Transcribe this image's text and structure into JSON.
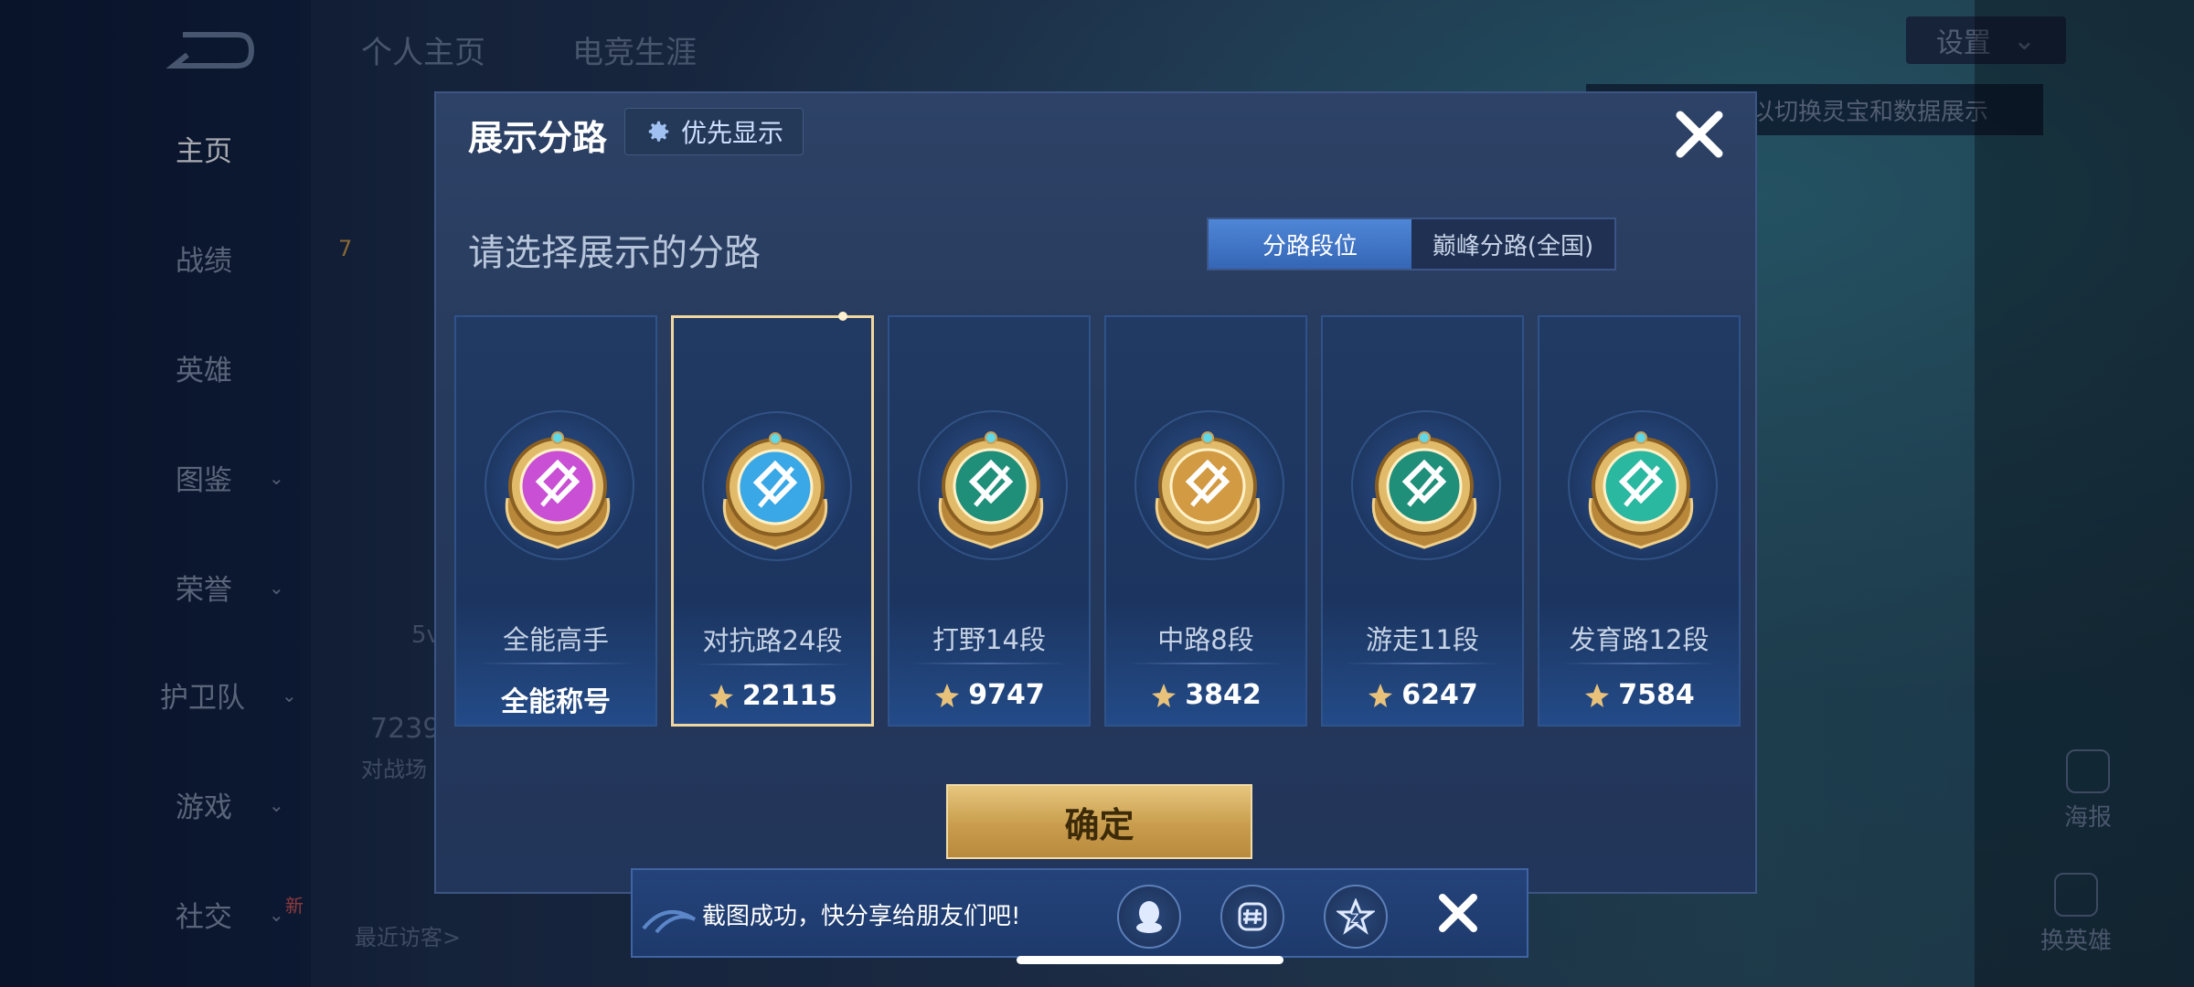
{
  "background": {
    "top_tabs": [
      "个人主页",
      "电竞生涯"
    ],
    "nav_items": [
      {
        "label": "主页",
        "has_chevron": false,
        "active": true
      },
      {
        "label": "战绩",
        "has_chevron": false,
        "active": false
      },
      {
        "label": "英雄",
        "has_chevron": false,
        "active": false
      },
      {
        "label": "图鉴",
        "has_chevron": true,
        "active": false
      },
      {
        "label": "荣誉",
        "has_chevron": true,
        "active": false
      },
      {
        "label": "护卫队",
        "has_chevron": true,
        "active": false
      },
      {
        "label": "游戏",
        "has_chevron": true,
        "active": false
      },
      {
        "label": "社交",
        "has_chevron": true,
        "active": false
      }
    ],
    "chevron": "⌄",
    "settings_label": "设置",
    "settings_chevron": "⌄",
    "hint_text": "以切换灵宝和数据展示",
    "side_buttons": [
      "海报",
      "换英雄"
    ],
    "partial_texts": {
      "level": "7",
      "game_count": "7239",
      "game_count_caption": "对战场",
      "recent": "最近访客>",
      "mode": "5v",
      "new_tag": "新"
    }
  },
  "dialog": {
    "title": "展示分路",
    "priority_label": "优先显示",
    "subtitle": "请选择展示的分路",
    "segments": [
      {
        "label": "分路段位",
        "active": true
      },
      {
        "label": "巅峰分路(全国)",
        "active": false
      }
    ],
    "cards": [
      {
        "label": "全能高手",
        "value": "全能称号",
        "show_icon": false,
        "selected": false,
        "badge_color": "#c94fd4",
        "icon": "all-round-badge-icon"
      },
      {
        "label": "对抗路24段",
        "value": "22115",
        "show_icon": true,
        "selected": true,
        "badge_color": "#3aa8e6",
        "icon": "clash-lane-badge-icon"
      },
      {
        "label": "打野14段",
        "value": "9747",
        "show_icon": true,
        "selected": false,
        "badge_color": "#1f8f7a",
        "icon": "jungle-badge-icon"
      },
      {
        "label": "中路8段",
        "value": "3842",
        "show_icon": true,
        "selected": false,
        "badge_color": "#d29a42",
        "icon": "mid-lane-badge-icon"
      },
      {
        "label": "游走11段",
        "value": "6247",
        "show_icon": true,
        "selected": false,
        "badge_color": "#1f8f7a",
        "icon": "roam-badge-icon"
      },
      {
        "label": "发育路12段",
        "value": "7584",
        "show_icon": true,
        "selected": false,
        "badge_color": "#2bb8a0",
        "icon": "farm-lane-badge-icon"
      }
    ],
    "confirm_label": "确定"
  },
  "share": {
    "text": "截图成功，快分享给朋友们吧!",
    "icons": [
      "qq-icon",
      "moments-icon",
      "qzone-icon"
    ]
  },
  "colors": {
    "accent_gold": "#e6c67e",
    "selected_border": "#f2d6a0",
    "segment_active": "#3f76c6"
  }
}
